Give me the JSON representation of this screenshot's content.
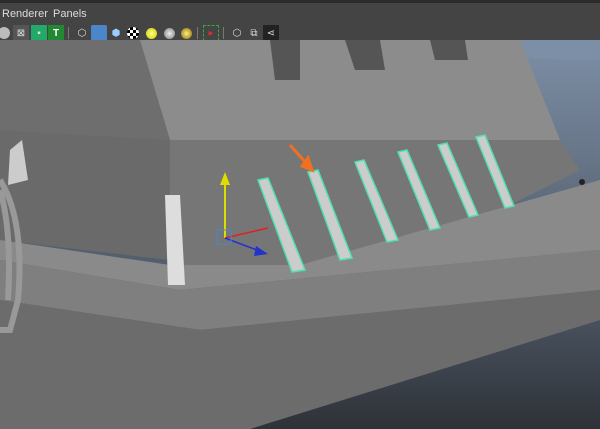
{
  "menu": {
    "items": [
      "Renderer",
      "Panels"
    ]
  },
  "toolbar": {
    "icons": [
      "sphere-icon",
      "xray-icon",
      "textured-icon",
      "text-icon",
      "wireframe-cube-icon",
      "shaded-cube-icon",
      "smooth-shaded-cube-icon",
      "checker-icon",
      "light-default-icon",
      "light-all-icon",
      "light-sphere-icon",
      "select-highlight-icon",
      "isolate-icon",
      "bounding-box-icon",
      "connections-icon"
    ],
    "text_icon_label": "T"
  },
  "colors": {
    "accent_selection": "#4fe0b0",
    "arrow": "#f07020"
  }
}
